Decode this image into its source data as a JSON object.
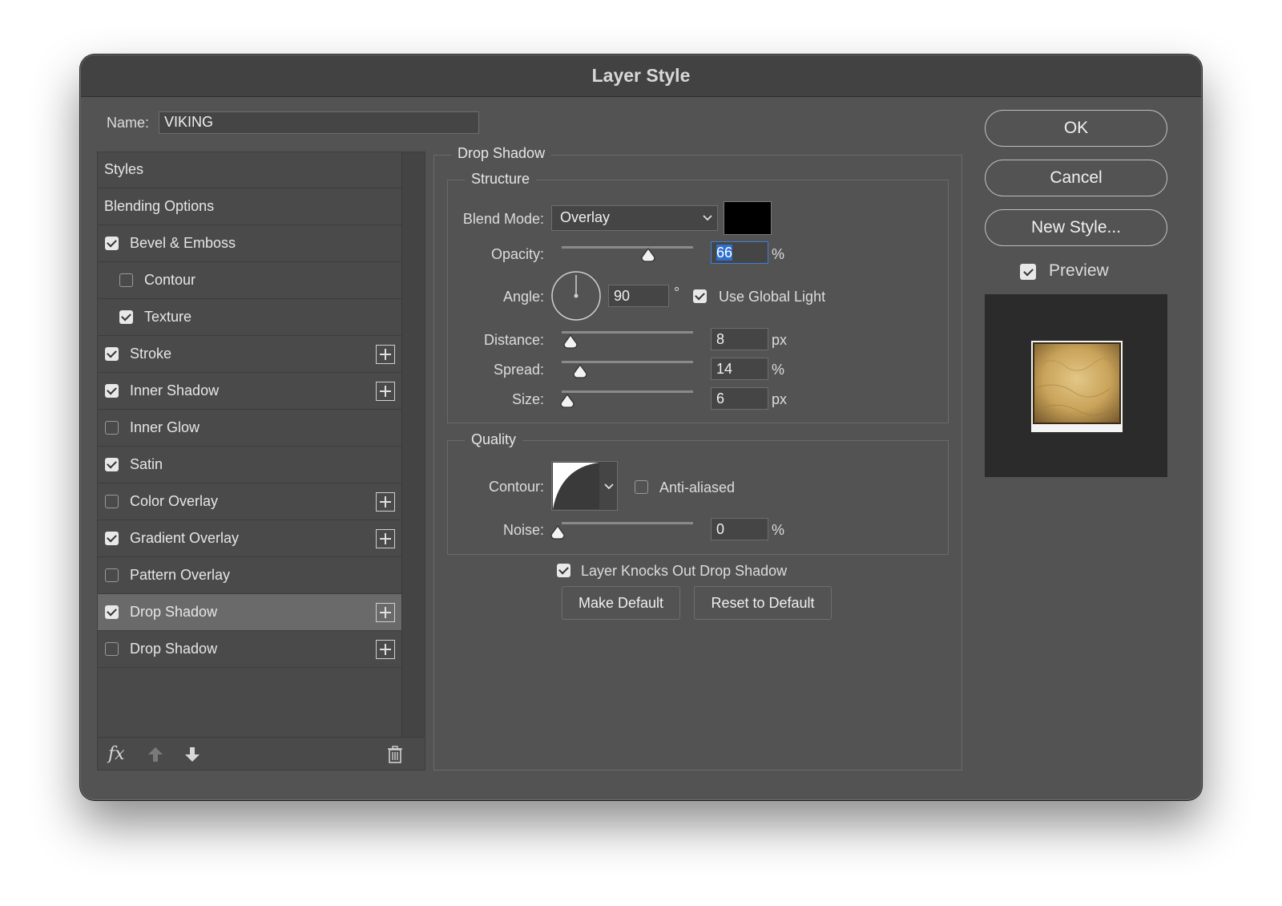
{
  "dialog": {
    "title": "Layer Style"
  },
  "name_field": {
    "label": "Name:",
    "value": "VIKING"
  },
  "styles_list": [
    {
      "label": "Styles",
      "checkbox": null,
      "indent": false,
      "plus": false,
      "selected": false
    },
    {
      "label": "Blending Options",
      "checkbox": null,
      "indent": false,
      "plus": false,
      "selected": false
    },
    {
      "label": "Bevel & Emboss",
      "checkbox": true,
      "indent": false,
      "plus": false,
      "selected": false
    },
    {
      "label": "Contour",
      "checkbox": false,
      "indent": true,
      "plus": false,
      "selected": false
    },
    {
      "label": "Texture",
      "checkbox": true,
      "indent": true,
      "plus": false,
      "selected": false
    },
    {
      "label": "Stroke",
      "checkbox": true,
      "indent": false,
      "plus": true,
      "selected": false
    },
    {
      "label": "Inner Shadow",
      "checkbox": true,
      "indent": false,
      "plus": true,
      "selected": false
    },
    {
      "label": "Inner Glow",
      "checkbox": false,
      "indent": false,
      "plus": false,
      "selected": false
    },
    {
      "label": "Satin",
      "checkbox": true,
      "indent": false,
      "plus": false,
      "selected": false
    },
    {
      "label": "Color Overlay",
      "checkbox": false,
      "indent": false,
      "plus": true,
      "selected": false
    },
    {
      "label": "Gradient Overlay",
      "checkbox": true,
      "indent": false,
      "plus": true,
      "selected": false
    },
    {
      "label": "Pattern Overlay",
      "checkbox": false,
      "indent": false,
      "plus": false,
      "selected": false
    },
    {
      "label": "Drop Shadow",
      "checkbox": true,
      "indent": false,
      "plus": true,
      "selected": true
    },
    {
      "label": "Drop Shadow",
      "checkbox": false,
      "indent": false,
      "plus": true,
      "selected": false
    }
  ],
  "footer": {
    "fx_label": "fx"
  },
  "drop_shadow": {
    "section_title": "Drop Shadow",
    "structure": {
      "title": "Structure",
      "blend_mode_label": "Blend Mode:",
      "blend_mode_value": "Overlay",
      "shadow_color": "#000000",
      "opacity_label": "Opacity:",
      "opacity_value": "66",
      "opacity_unit": "%",
      "opacity_fraction": 0.66,
      "angle_label": "Angle:",
      "angle_value": "90",
      "angle_unit": "°",
      "use_global_light_label": "Use Global Light",
      "use_global_light_checked": true,
      "distance_label": "Distance:",
      "distance_value": "8",
      "distance_unit": "px",
      "spread_label": "Spread:",
      "spread_value": "14",
      "spread_unit": "%",
      "spread_fraction": 0.14,
      "size_label": "Size:",
      "size_value": "6",
      "size_unit": "px"
    },
    "quality": {
      "title": "Quality",
      "contour_label": "Contour:",
      "anti_aliased_label": "Anti-aliased",
      "anti_aliased_checked": false,
      "noise_label": "Noise:",
      "noise_value": "0",
      "noise_unit": "%"
    },
    "knockout_label": "Layer Knocks Out Drop Shadow",
    "knockout_checked": true,
    "make_default_label": "Make Default",
    "reset_default_label": "Reset to Default"
  },
  "actions": {
    "ok_label": "OK",
    "cancel_label": "Cancel",
    "new_style_label": "New Style...",
    "preview_label": "Preview",
    "preview_checked": true
  },
  "colors": {
    "accent_selection": "#2f6fd0",
    "preview_gold": "#c9a35a"
  }
}
